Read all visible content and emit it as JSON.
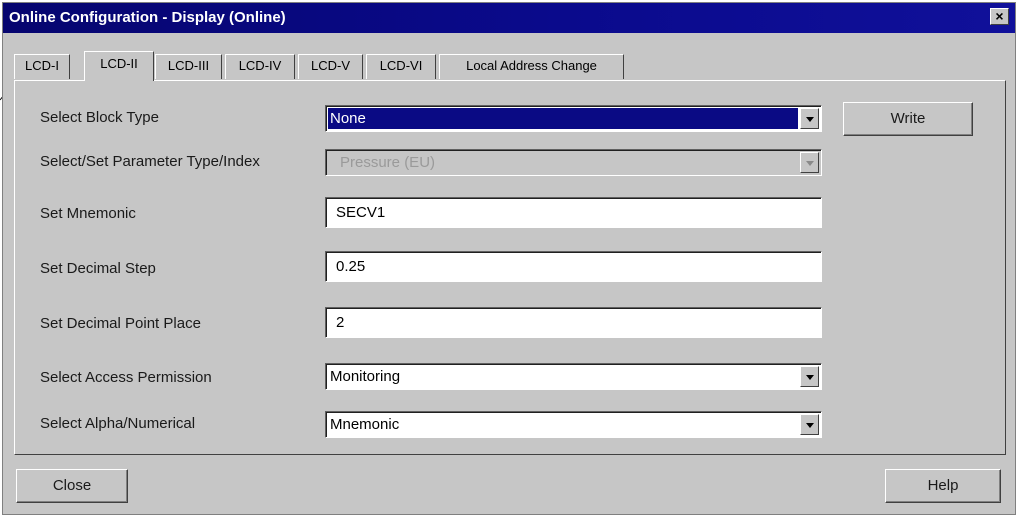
{
  "window": {
    "title": "Online Configuration - Display  (Online)",
    "close_glyph": "×"
  },
  "tabs": [
    {
      "label": "LCD-I",
      "active": false
    },
    {
      "label": "LCD-II",
      "active": true
    },
    {
      "label": "LCD-III",
      "active": false
    },
    {
      "label": "LCD-IV",
      "active": false
    },
    {
      "label": "LCD-V",
      "active": false
    },
    {
      "label": "LCD-VI",
      "active": false
    },
    {
      "label": "Local Address Change",
      "active": false
    }
  ],
  "form": {
    "block_type": {
      "label": "Select Block Type",
      "value": "None"
    },
    "param_type": {
      "label": "Select/Set Parameter Type/Index",
      "value": "Pressure (EU)",
      "disabled": true
    },
    "mnemonic": {
      "label": "Set Mnemonic",
      "value": "SECV1"
    },
    "decimal_step": {
      "label": "Set Decimal Step",
      "value": "0.25"
    },
    "decimal_point": {
      "label": "Set Decimal Point Place",
      "value": "2"
    },
    "access_permission": {
      "label": "Select Access Permission",
      "value": "Monitoring"
    },
    "alpha_numerical": {
      "label": "Select Alpha/Numerical",
      "value": "Mnemonic"
    }
  },
  "buttons": {
    "write": "Write",
    "close": "Close",
    "help": "Help"
  },
  "colors": {
    "titlebar": "#0a0a8c",
    "face": "#c6c6c6",
    "selection": "#0a0a84"
  }
}
